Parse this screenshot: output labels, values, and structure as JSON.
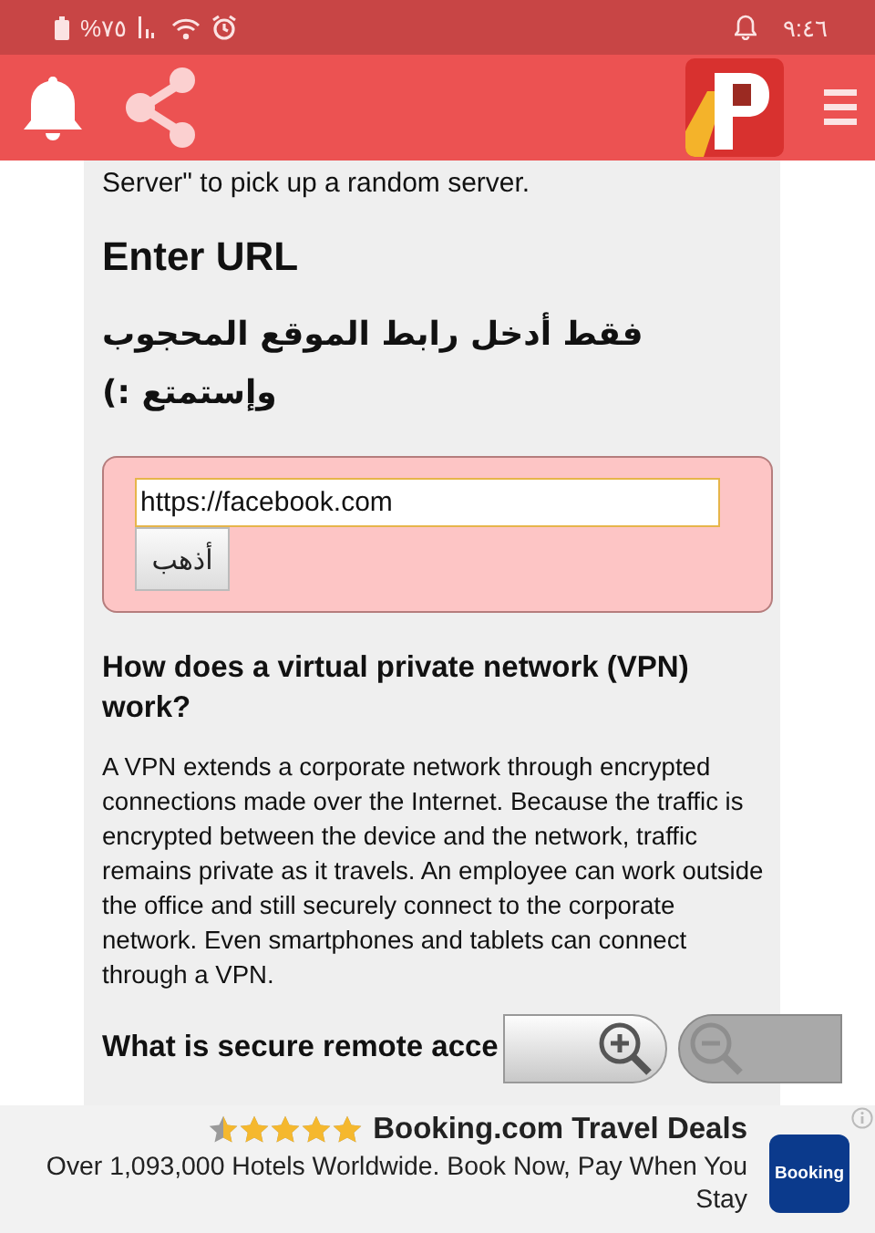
{
  "status_bar": {
    "battery": "%٧٥",
    "time": "٩:٤٦"
  },
  "article": {
    "intro_tail": "Server\" to pick up a random server.",
    "title": "Enter URL",
    "arabic_prompt": "فقط أدخل رابط الموقع المحجوب وإستمتع :)",
    "form": {
      "url_value": "https://facebook.com",
      "go_button": "أذهب"
    },
    "sections": [
      {
        "heading": "How does a virtual private network (VPN) work?",
        "body": "A VPN extends a corporate network through encrypted connections made over the Internet. Because the traffic is encrypted between the device and the network, traffic remains private as it travels. An employee can work outside the office and still securely connect to the corporate network. Even smartphones and tablets can connect through a VPN."
      },
      {
        "heading": "What is secure remote acce"
      }
    ]
  },
  "zoom_controls": [
    {
      "kind": "zoom_in",
      "disabled": false
    },
    {
      "kind": "zoom_out",
      "disabled": true
    }
  ],
  "ad": {
    "stars": 4.5,
    "title": "Booking.com Travel Deals",
    "description": "Over 1,093,000 Hotels Worldwide. Book Now, Pay When You Stay",
    "logo_text": "Booking"
  }
}
